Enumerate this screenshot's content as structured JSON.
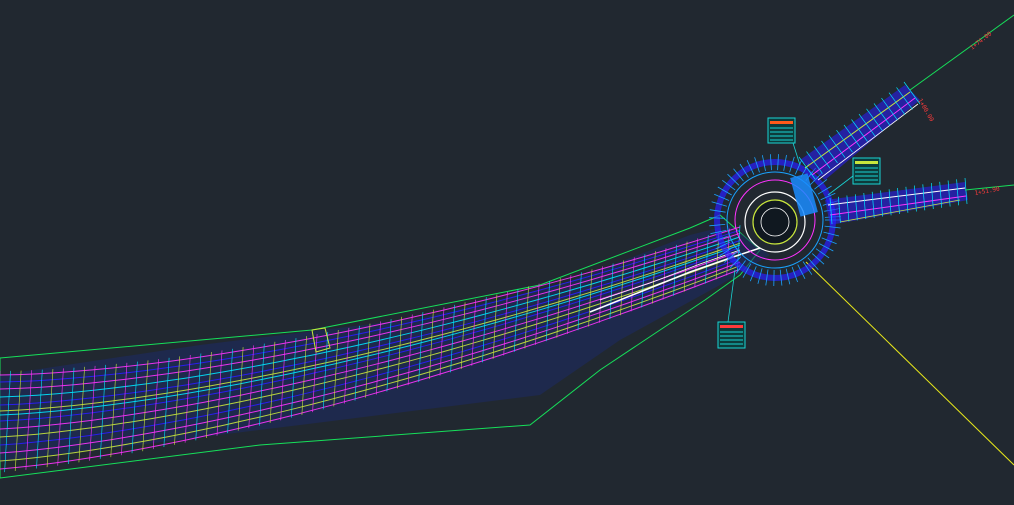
{
  "drawing": {
    "background": "#212830",
    "colors": {
      "boundary": "#16e05a",
      "lane": "#ff33ff",
      "structure": "#2a1cff",
      "profile": "#00e5ff",
      "edge": "#ffffff",
      "grading": "#c8e63c",
      "leader": "#e8e81a",
      "accent": "#ff3b3b"
    },
    "station_labels": [
      {
        "id": "ne-branch",
        "text": "1+00.00",
        "color": "#ff3b3b"
      },
      {
        "id": "e-branch",
        "text": "1+51.90",
        "color": "#ff3b3b"
      },
      {
        "id": "ne-spur",
        "text": "1+74.00",
        "color": "#ff3b3b"
      }
    ],
    "tags": [
      {
        "id": "tag-north",
        "color": "#19d4d4",
        "accent": "#ff5a1a"
      },
      {
        "id": "tag-east",
        "color": "#19d4d4",
        "accent": "#c8e63c"
      },
      {
        "id": "tag-south",
        "color": "#19d4d4",
        "accent": "#ff3b3b"
      }
    ]
  }
}
